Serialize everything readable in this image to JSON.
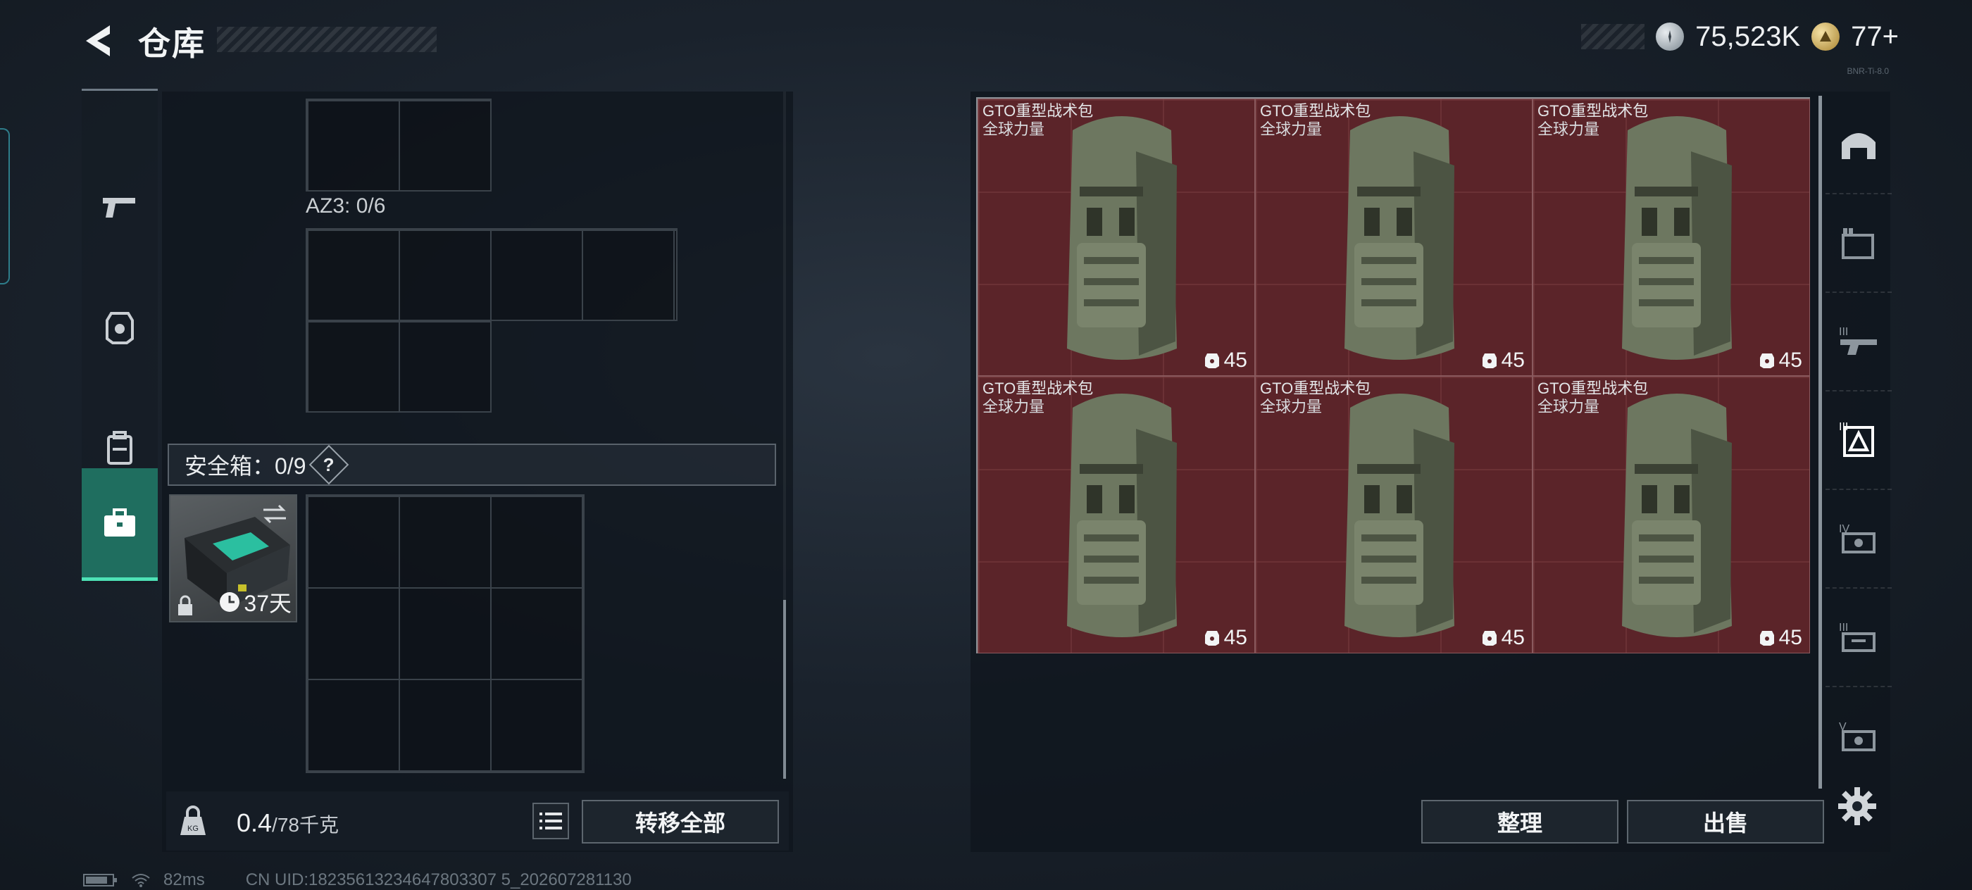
{
  "header": {
    "title": "仓库",
    "currency_silver": "75,523K",
    "currency_gold": "77+",
    "tiny_tag": "BNR-Ti-8.0"
  },
  "left_nav": {
    "items": [
      {
        "name": "weapons",
        "icon": "pistol-icon"
      },
      {
        "name": "armor",
        "icon": "helmet-icon"
      },
      {
        "name": "backpack",
        "icon": "backpack-icon"
      },
      {
        "name": "safe-box",
        "icon": "briefcase-icon",
        "active": true
      }
    ]
  },
  "left_panel": {
    "az3_label": "AZ3: 0/6",
    "safe_box_label": "安全箱：0/9",
    "safe_help": "?",
    "safe_box_time": "37天",
    "weight_current": "0.4",
    "weight_max": "/78千克",
    "transfer_all": "转移全部"
  },
  "stash": {
    "items": [
      {
        "name": "GTO重型战术包",
        "sub": "全球力量",
        "level": "45"
      },
      {
        "name": "GTO重型战术包",
        "sub": "全球力量",
        "level": "45"
      },
      {
        "name": "GTO重型战术包",
        "sub": "全球力量",
        "level": "45"
      },
      {
        "name": "GTO重型战术包",
        "sub": "全球力量",
        "level": "45"
      },
      {
        "name": "GTO重型战术包",
        "sub": "全球力量",
        "level": "45"
      },
      {
        "name": "GTO重型战术包",
        "sub": "全球力量",
        "level": "45"
      }
    ],
    "sort_label": "整理",
    "sell_label": "出售"
  },
  "status": {
    "ping": "82ms",
    "uid": "CN UID:18235613234647803307 5_202607281130"
  },
  "colors": {
    "accent_green": "#4ee2b6",
    "item_bg": "#5b2429"
  }
}
